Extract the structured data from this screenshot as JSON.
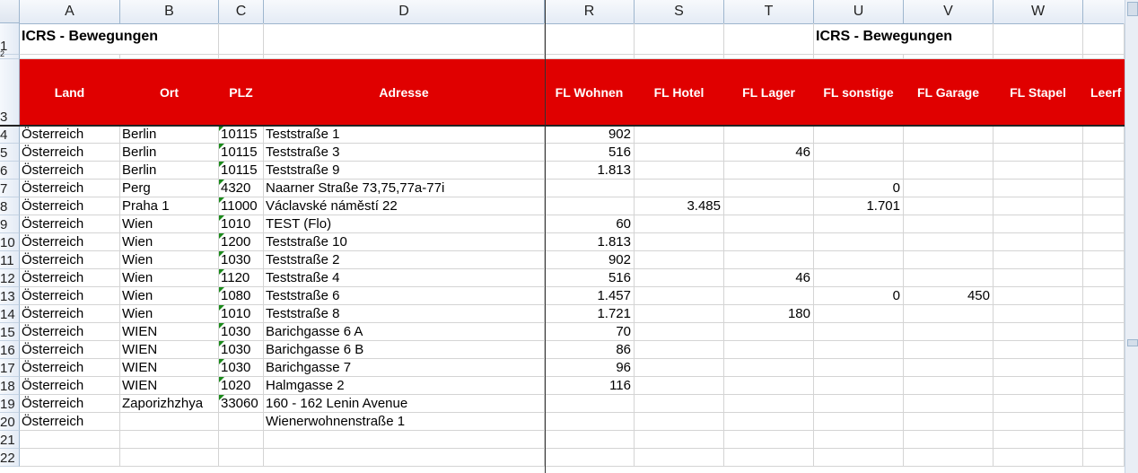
{
  "columns": [
    "A",
    "B",
    "C",
    "D",
    "R",
    "S",
    "T",
    "U",
    "V",
    "W"
  ],
  "rows": [
    "1",
    "2",
    "3",
    "4",
    "5",
    "6",
    "7",
    "8",
    "9",
    "10",
    "11",
    "12",
    "13",
    "14",
    "15",
    "16",
    "17",
    "18",
    "19",
    "20",
    "21",
    "22"
  ],
  "titles": {
    "left": "ICRS - Bewegungen",
    "right": "ICRS - Bewegungen"
  },
  "headers": [
    "Land",
    "Ort",
    "PLZ",
    "Adresse",
    "FL Wohnen",
    "FL Hotel",
    "FL Lager",
    "FL sonstige",
    "FL Garage",
    "FL Stapel",
    "Leerf"
  ],
  "data": [
    [
      "Österreich",
      "Berlin",
      "10115",
      "Teststraße 1",
      "902",
      "",
      "",
      "",
      "",
      ""
    ],
    [
      "Österreich",
      "Berlin",
      "10115",
      "Teststraße 3",
      "516",
      "",
      "46",
      "",
      "",
      ""
    ],
    [
      "Österreich",
      "Berlin",
      "10115",
      "Teststraße 9",
      "1.813",
      "",
      "",
      "",
      "",
      ""
    ],
    [
      "Österreich",
      "Perg",
      "4320",
      "Naarner Straße 73,75,77a-77i",
      "",
      "",
      "",
      "0",
      "",
      ""
    ],
    [
      "Österreich",
      "Praha 1",
      "11000",
      "Václavské náměstí 22",
      "",
      "3.485",
      "",
      "1.701",
      "",
      ""
    ],
    [
      "Österreich",
      "Wien",
      "1010",
      "TEST (Flo)",
      "60",
      "",
      "",
      "",
      "",
      ""
    ],
    [
      "Österreich",
      "Wien",
      "1200",
      "Teststraße 10",
      "1.813",
      "",
      "",
      "",
      "",
      ""
    ],
    [
      "Österreich",
      "Wien",
      "1030",
      "Teststraße 2",
      "902",
      "",
      "",
      "",
      "",
      ""
    ],
    [
      "Österreich",
      "Wien",
      "1120",
      "Teststraße 4",
      "516",
      "",
      "46",
      "",
      "",
      ""
    ],
    [
      "Österreich",
      "Wien",
      "1080",
      "Teststraße 6",
      "1.457",
      "",
      "",
      "0",
      "450",
      ""
    ],
    [
      "Österreich",
      "Wien",
      "1010",
      "Teststraße 8",
      "1.721",
      "",
      "180",
      "",
      "",
      ""
    ],
    [
      "Österreich",
      "WIEN",
      "1030",
      "Barichgasse 6 A",
      "70",
      "",
      "",
      "",
      "",
      ""
    ],
    [
      "Österreich",
      "WIEN",
      "1030",
      "Barichgasse 6 B",
      "86",
      "",
      "",
      "",
      "",
      ""
    ],
    [
      "Österreich",
      "WIEN",
      "1030",
      "Barichgasse 7",
      "96",
      "",
      "",
      "",
      "",
      ""
    ],
    [
      "Österreich",
      "WIEN",
      "1020",
      "Halmgasse 2",
      "116",
      "",
      "",
      "",
      "",
      ""
    ],
    [
      "Österreich",
      "Zaporizhzhya",
      "33060",
      "160 - 162 Lenin Avenue",
      "",
      "",
      "",
      "",
      "",
      ""
    ],
    [
      "Österreich",
      "",
      "",
      "Wienerwohnenstraße 1",
      "",
      "",
      "",
      "",
      "",
      ""
    ],
    [
      "",
      "",
      "",
      "",
      "",
      "",
      "",
      "",
      "",
      ""
    ],
    [
      "",
      "",
      "",
      "",
      "",
      "",
      "",
      "",
      "",
      ""
    ]
  ],
  "colors": {
    "header_red": "#e00000",
    "plz_marker": "#1a8a1a"
  }
}
